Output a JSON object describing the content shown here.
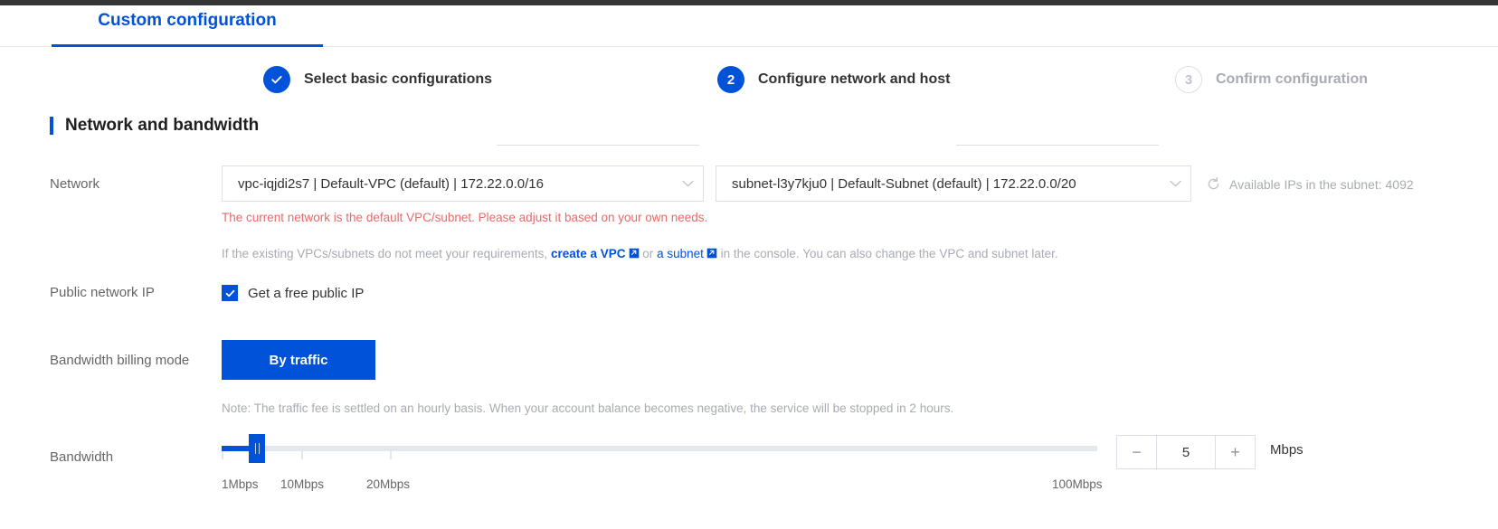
{
  "tabs": {
    "active_label": "Custom configuration"
  },
  "steps": [
    {
      "number": "✓",
      "label": "Select basic configurations",
      "state": "done"
    },
    {
      "number": "2",
      "label": "Configure network and host",
      "state": "active"
    },
    {
      "number": "3",
      "label": "Confirm configuration",
      "state": "todo"
    }
  ],
  "section": {
    "title": "Network and bandwidth"
  },
  "network": {
    "label": "Network",
    "vpc_value": "vpc-iqjdi2s7 | Default-VPC (default) | 172.22.0.0/16",
    "subnet_value": "subnet-l3y7kju0 | Default-Subnet (default) | 172.22.0.0/20",
    "available_ips": "Available IPs in the subnet: 4092",
    "warning": "The current network is the default VPC/subnet. Please adjust it based on your own needs.",
    "help_prefix": "If the existing VPCs/subnets do not meet your requirements,",
    "help_link_vpc": "create a VPC",
    "help_or": "or",
    "help_link_subnet": "a subnet",
    "help_suffix": "in the console. You can also change the VPC and subnet later."
  },
  "public_ip": {
    "label": "Public network IP",
    "checkbox_label": "Get a free public IP",
    "checked": true
  },
  "billing": {
    "label": "Bandwidth billing mode",
    "selected_option": "By traffic",
    "note": "Note: The traffic fee is settled on an hourly basis. When your account balance becomes negative, the service will be stopped in 2 hours."
  },
  "bandwidth": {
    "label": "Bandwidth",
    "value": "5",
    "unit": "Mbps",
    "minus_label": "−",
    "plus_label": "+",
    "min": 1,
    "max": 100,
    "ticks": [
      {
        "label": "1Mbps",
        "value": 1
      },
      {
        "label": "10Mbps",
        "value": 10
      },
      {
        "label": "20Mbps",
        "value": 20
      },
      {
        "label": "100Mbps",
        "value": 100
      }
    ]
  },
  "colors": {
    "accent": "#0052d9",
    "warning": "#e96a6a",
    "muted": "#a8abb2"
  }
}
